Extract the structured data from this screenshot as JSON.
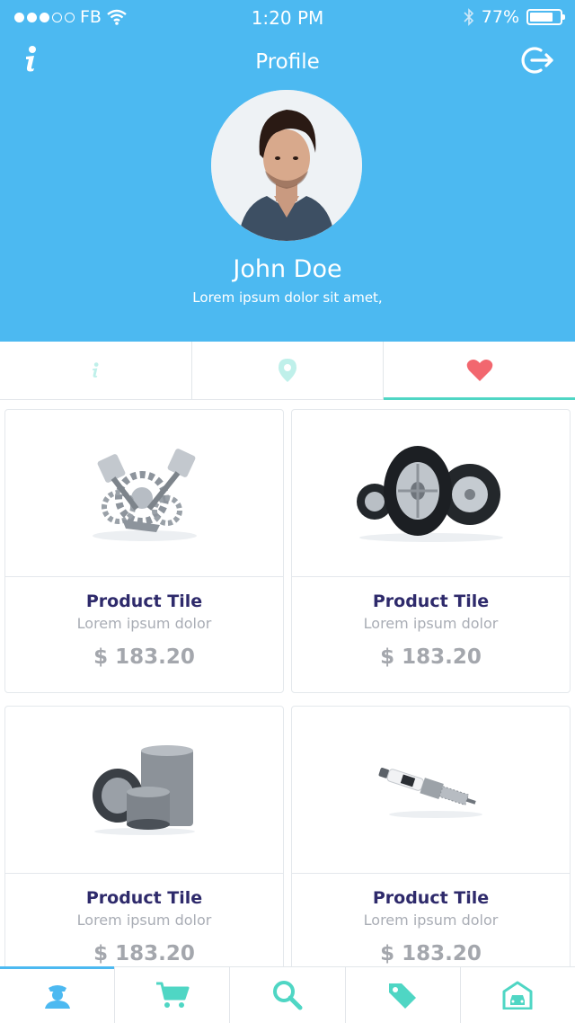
{
  "status_bar": {
    "carrier": "FB",
    "time": "1:20 PM",
    "battery": "77%",
    "battery_level": 0.77
  },
  "nav": {
    "title": "Profile",
    "left_icon": "info-icon",
    "right_icon": "logout-icon"
  },
  "profile": {
    "name": "John Doe",
    "bio": "Lorem ipsum dolor sit amet,"
  },
  "tabs": [
    {
      "icon": "info-icon",
      "active": false
    },
    {
      "icon": "location-pin-icon",
      "active": false
    },
    {
      "icon": "heart-icon",
      "active": true
    }
  ],
  "products": [
    {
      "image": "engine-image",
      "title": "Product Tile",
      "subtitle": "Lorem ipsum dolor",
      "price": "$ 183.20"
    },
    {
      "image": "tires-image",
      "title": "Product Tile",
      "subtitle": "Lorem ipsum dolor",
      "price": "$ 183.20"
    },
    {
      "image": "air-filter-image",
      "title": "Product Tile",
      "subtitle": "Lorem ipsum dolor",
      "price": "$ 183.20"
    },
    {
      "image": "spark-plug-image",
      "title": "Product Tile",
      "subtitle": "Lorem ipsum dolor",
      "price": "$ 183.20"
    }
  ],
  "bottom_nav": [
    {
      "icon": "driver-profile-icon",
      "active": true
    },
    {
      "icon": "cart-icon",
      "active": false
    },
    {
      "icon": "search-icon",
      "active": false
    },
    {
      "icon": "tag-icon",
      "active": false
    },
    {
      "icon": "garage-icon",
      "active": false
    }
  ],
  "colors": {
    "primary": "#4cb9f1",
    "accent": "#4fd6c4",
    "heart": "#f2676f",
    "title": "#2e2a6b"
  }
}
